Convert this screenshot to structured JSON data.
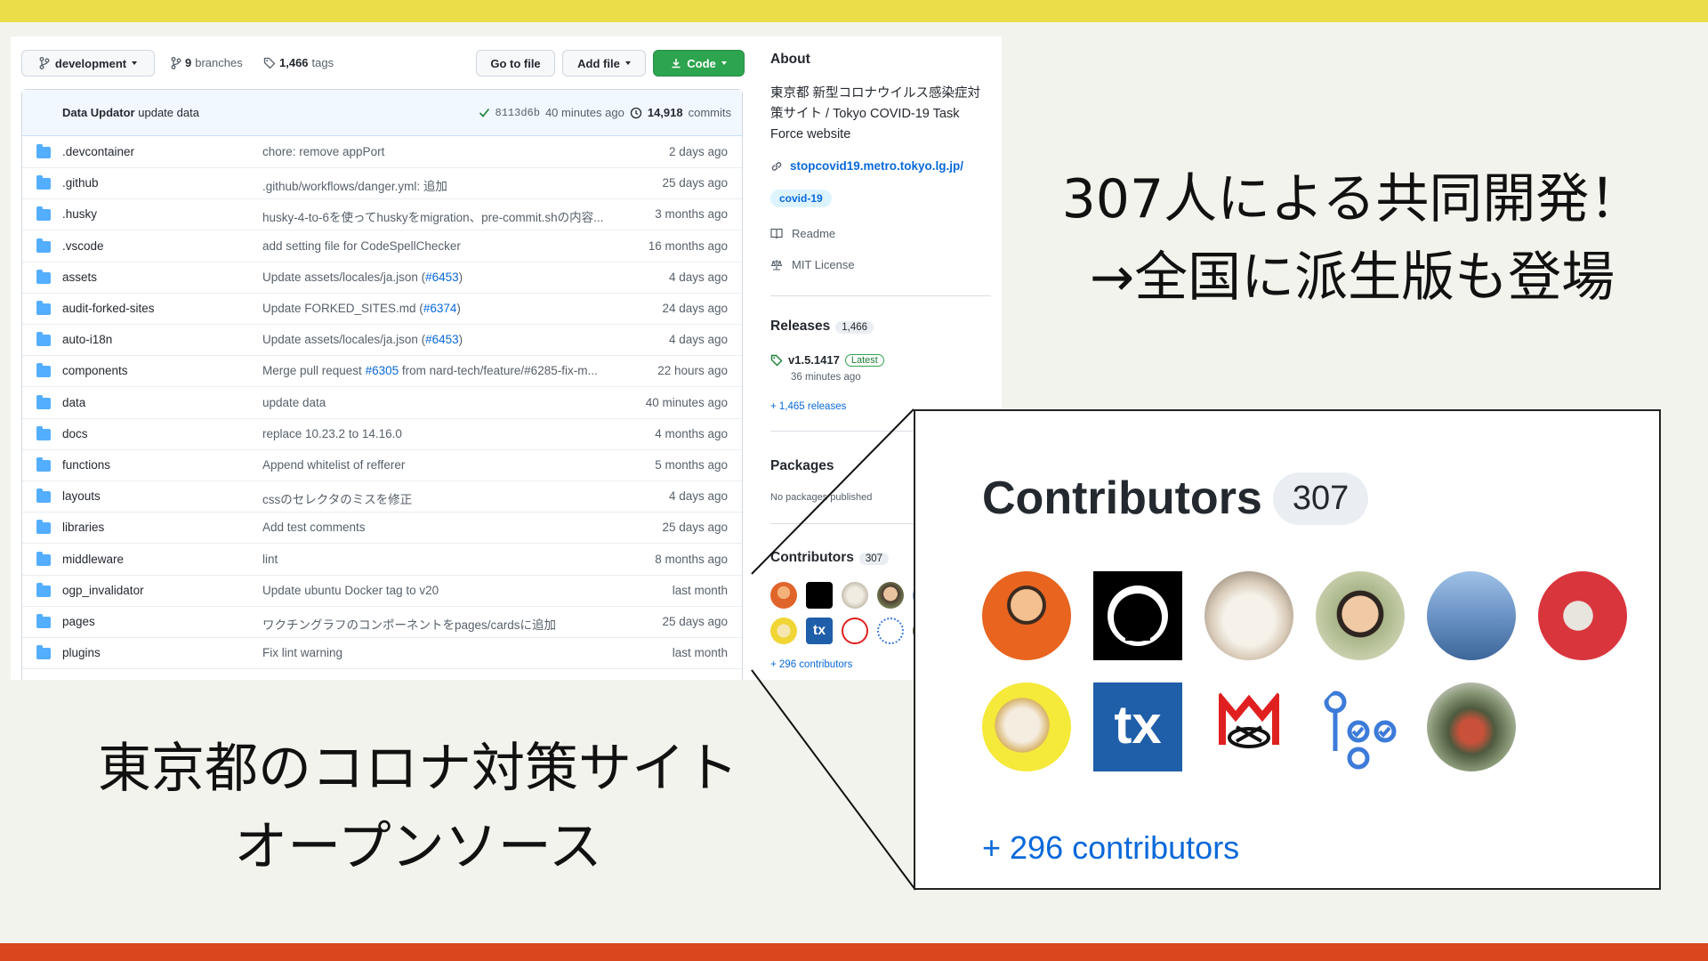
{
  "toolbar": {
    "branch_label": "development",
    "branches_count": "9",
    "branches_label": "branches",
    "tags_count": "1,466",
    "tags_label": "tags",
    "go_to_file": "Go to file",
    "add_file": "Add file",
    "code": "Code"
  },
  "commit": {
    "author": "Data Updator",
    "message": "update data",
    "sha": "8113d6b",
    "time": "40 minutes ago",
    "commits_count": "14,918",
    "commits_label": "commits"
  },
  "files": [
    {
      "name": ".devcontainer",
      "msg": "chore: remove appPort",
      "pr": "",
      "msg_after": "",
      "age": "2 days ago"
    },
    {
      "name": ".github",
      "msg": ".github/workflows/danger.yml: 追加",
      "pr": "",
      "msg_after": "",
      "age": "25 days ago"
    },
    {
      "name": ".husky",
      "msg": "husky-4-to-6を使ってhuskyをmigration、pre-commit.shの内容...",
      "pr": "",
      "msg_after": "",
      "age": "3 months ago"
    },
    {
      "name": ".vscode",
      "msg": "add setting file for CodeSpellChecker",
      "pr": "",
      "msg_after": "",
      "age": "16 months ago"
    },
    {
      "name": "assets",
      "msg": "Update assets/locales/ja.json (",
      "pr": "#6453",
      "msg_after": ")",
      "age": "4 days ago"
    },
    {
      "name": "audit-forked-sites",
      "msg": "Update FORKED_SITES.md (",
      "pr": "#6374",
      "msg_after": ")",
      "age": "24 days ago"
    },
    {
      "name": "auto-i18n",
      "msg": "Update assets/locales/ja.json (",
      "pr": "#6453",
      "msg_after": ")",
      "age": "4 days ago"
    },
    {
      "name": "components",
      "msg": "Merge pull request ",
      "pr": "#6305",
      "msg_after": " from nard-tech/feature/#6285-fix-m...",
      "age": "22 hours ago"
    },
    {
      "name": "data",
      "msg": "update data",
      "pr": "",
      "msg_after": "",
      "age": "40 minutes ago"
    },
    {
      "name": "docs",
      "msg": "replace 10.23.2 to 14.16.0",
      "pr": "",
      "msg_after": "",
      "age": "4 months ago"
    },
    {
      "name": "functions",
      "msg": "Append whitelist of refferer",
      "pr": "",
      "msg_after": "",
      "age": "5 months ago"
    },
    {
      "name": "layouts",
      "msg": "cssのセレクタのミスを修正",
      "pr": "",
      "msg_after": "",
      "age": "4 days ago"
    },
    {
      "name": "libraries",
      "msg": "Add test comments",
      "pr": "",
      "msg_after": "",
      "age": "25 days ago"
    },
    {
      "name": "middleware",
      "msg": "lint",
      "pr": "",
      "msg_after": "",
      "age": "8 months ago"
    },
    {
      "name": "ogp_invalidator",
      "msg": "Update ubuntu Docker tag to v20",
      "pr": "",
      "msg_after": "",
      "age": "last month"
    },
    {
      "name": "pages",
      "msg": "ワクチングラフのコンポーネントをpages/cardsに追加",
      "pr": "",
      "msg_after": "",
      "age": "25 days ago"
    },
    {
      "name": "plugins",
      "msg": "Fix lint warning",
      "pr": "",
      "msg_after": "",
      "age": "last month"
    }
  ],
  "about": {
    "heading": "About",
    "description": "東京都 新型コロナウイルス感染症対策サイト / Tokyo COVID-19 Task Force website",
    "website": "stopcovid19.metro.tokyo.lg.jp/",
    "topic": "covid-19",
    "readme": "Readme",
    "license": "MIT License"
  },
  "releases": {
    "heading": "Releases",
    "count": "1,466",
    "tag": "v1.5.1417",
    "latest": "Latest",
    "time": "36 minutes ago",
    "more": "+ 1,465 releases"
  },
  "packages": {
    "heading": "Packages",
    "none": "No packages published"
  },
  "contributors": {
    "heading": "Contributors",
    "count": "307",
    "more": "+ 296 contributors",
    "avatars": [
      "orange-person",
      "github-octocat",
      "white-cat",
      "smiling-person",
      "sea-landscape",
      "red-robot",
      "trumpet-player",
      "tx-logo",
      "musician-logo",
      "renovate-bot",
      "street-photo"
    ]
  },
  "zoom": {
    "heading": "Contributors",
    "count": "307",
    "more": "+ 296 contributors",
    "tx": "tx"
  },
  "captions": {
    "right_line1": "307人による共同開発！",
    "right_line2": "→全国に派生版も登場",
    "left_line1": "東京都のコロナ対策サイト",
    "left_line2": "オープンソース"
  },
  "colors": {
    "top_bar": "#ebdd48",
    "bottom_bar": "#d9471f",
    "link": "#0969da",
    "code_button": "#2da44e"
  }
}
